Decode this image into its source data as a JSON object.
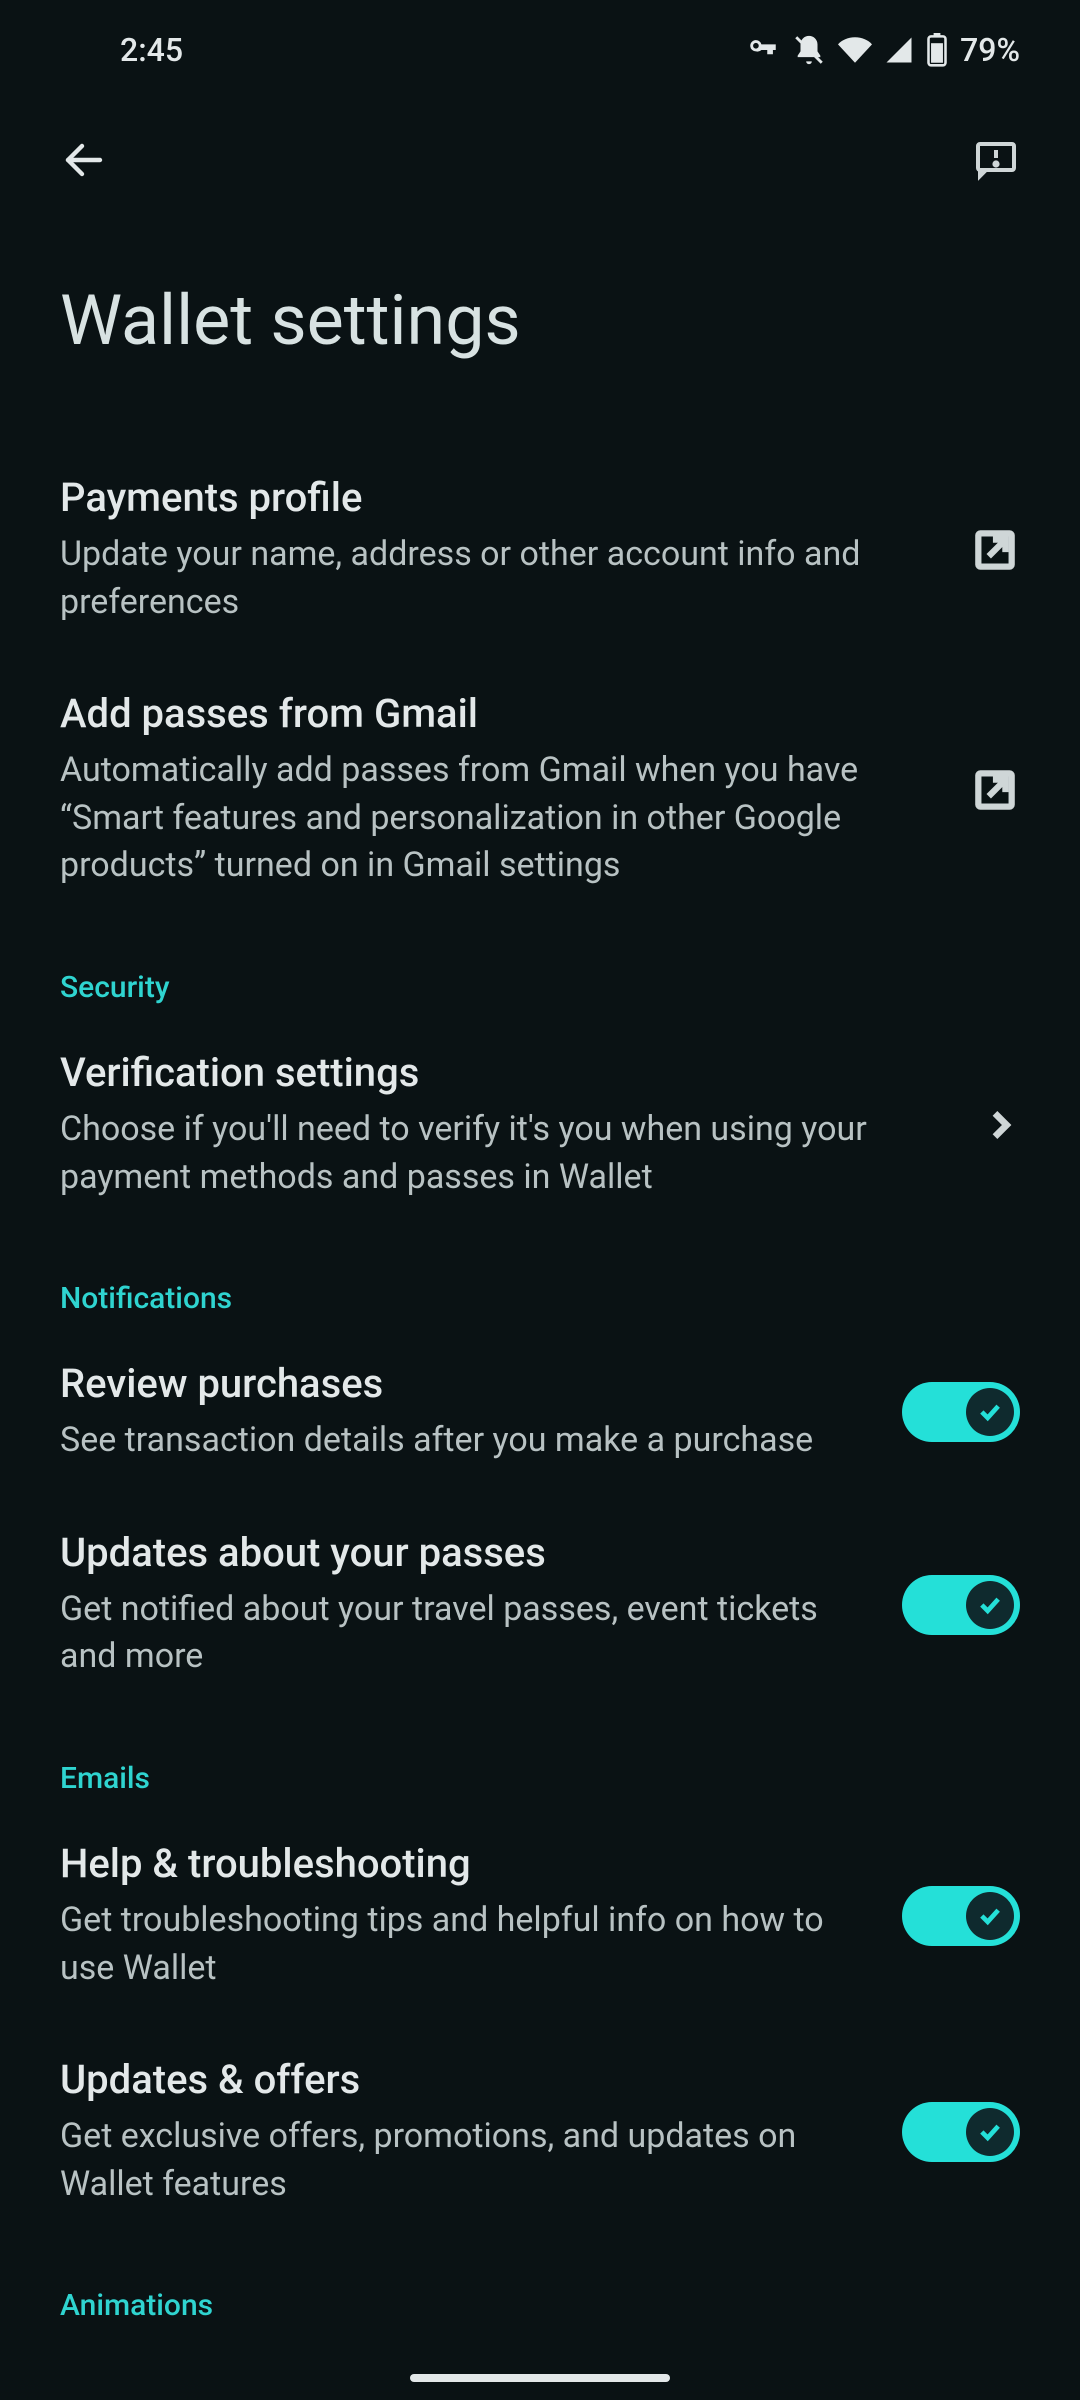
{
  "status": {
    "time": "2:45",
    "battery": "79%"
  },
  "page": {
    "title": "Wallet settings"
  },
  "items": {
    "payments_profile": {
      "title": "Payments profile",
      "sub": "Update your name, address or other account info and preferences"
    },
    "add_passes_gmail": {
      "title": "Add passes from Gmail",
      "sub": "Automatically add passes from Gmail when you have “Smart features and personalization in other Google products” turned on in Gmail settings"
    },
    "verification": {
      "title": "Verification settings",
      "sub": "Choose if you'll need to verify it's you when using your payment methods and passes in Wallet"
    },
    "review_purchases": {
      "title": "Review purchases",
      "sub": "See transaction details after you make a purchase",
      "on": true
    },
    "updates_passes": {
      "title": "Updates about your passes",
      "sub": "Get notified about your travel passes, event tickets and more",
      "on": true
    },
    "help_troubleshooting": {
      "title": "Help & troubleshooting",
      "sub": "Get troubleshooting tips and helpful info on how to use Wallet",
      "on": true
    },
    "updates_offers": {
      "title": "Updates & offers",
      "sub": "Get exclusive offers, promotions, and updates on Wallet features",
      "on": true
    }
  },
  "sections": {
    "security": "Security",
    "notifications": "Notifications",
    "emails": "Emails",
    "animations": "Animations"
  }
}
